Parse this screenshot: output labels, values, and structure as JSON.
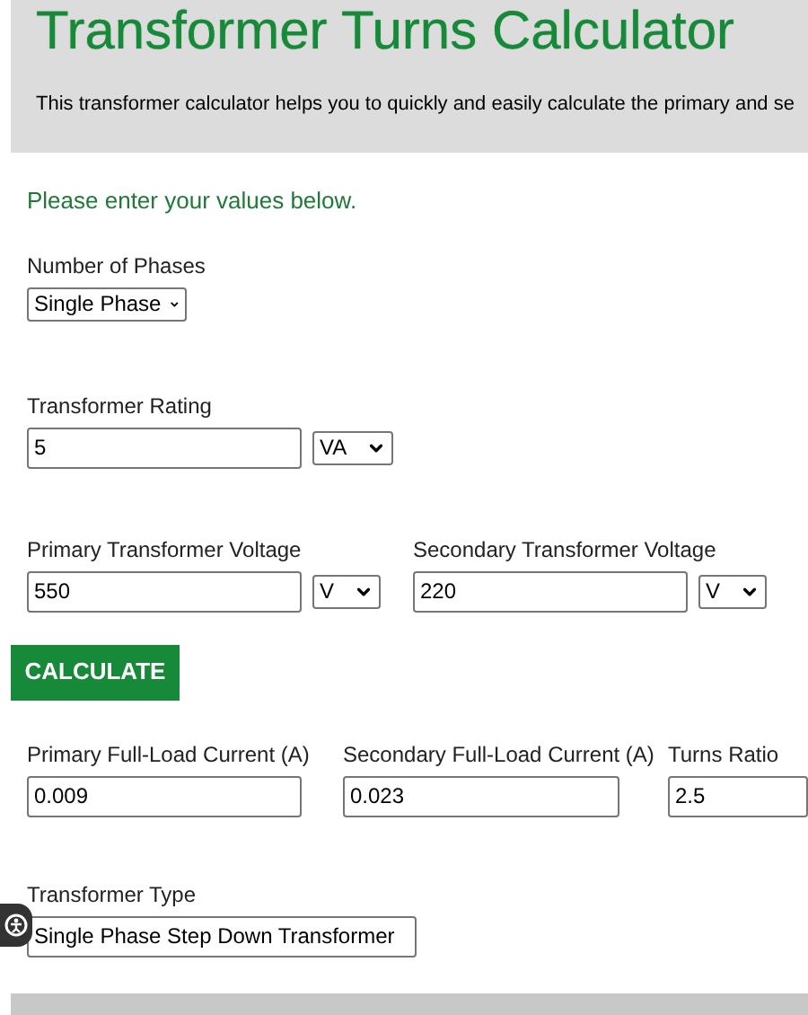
{
  "header": {
    "title": "Transformer Turns Calculator",
    "description": "This transformer calculator helps you to quickly and easily calculate the primary and se"
  },
  "intro": "Please enter your values below.",
  "phases": {
    "label": "Number of Phases",
    "value": "Single Phase"
  },
  "rating": {
    "label": "Transformer Rating",
    "value": "5",
    "unit": "VA"
  },
  "voltages": [
    {
      "label": "Primary Transformer Voltage",
      "value": "550",
      "unit": "V"
    },
    {
      "label": "Secondary Transformer Voltage",
      "value": "220",
      "unit": "V"
    }
  ],
  "calculate_button": "CALCULATE",
  "results": [
    {
      "label": "Primary Full-Load Current (A)",
      "value": "0.009"
    },
    {
      "label": "Secondary Full-Load Current (A)",
      "value": "0.023"
    },
    {
      "label": "Turns Ratio",
      "value": "2.5"
    }
  ],
  "transformer_type": {
    "label": "Transformer Type",
    "value": "Single Phase Step Down Transformer"
  }
}
